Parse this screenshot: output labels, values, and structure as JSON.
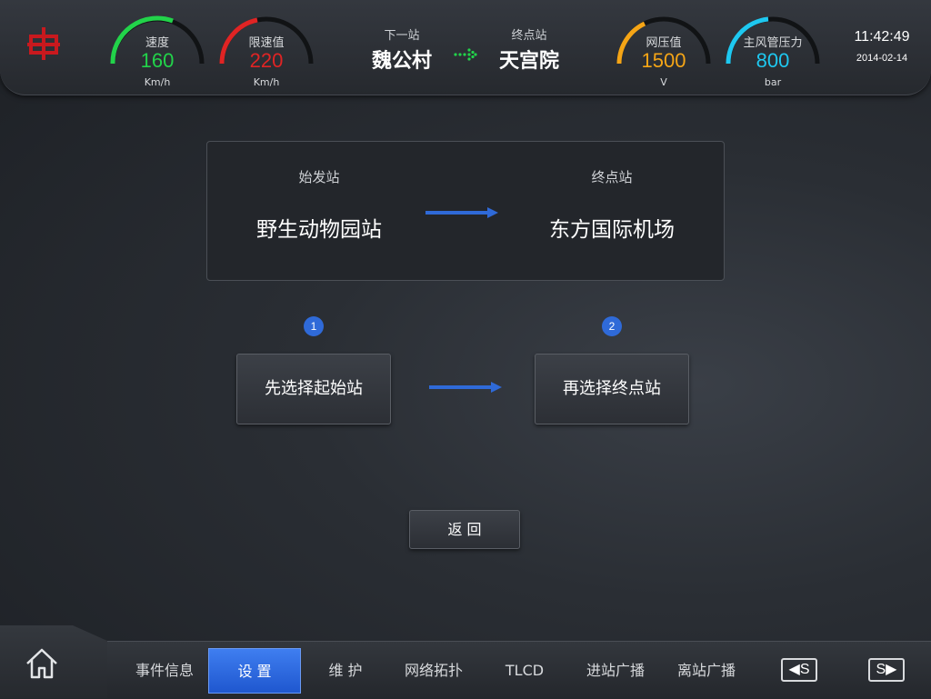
{
  "header": {
    "gauges": [
      {
        "label": "速度",
        "value": "160",
        "unit": "Km/h",
        "color": "#22d34a"
      },
      {
        "label": "限速值",
        "value": "220",
        "unit": "Km/h",
        "color": "#e02424"
      },
      {
        "label": "网压值",
        "value": "1500",
        "unit": "V",
        "color": "#f5a516"
      },
      {
        "label": "主风管压力",
        "value": "800",
        "unit": "bar",
        "color": "#1ec8f0"
      }
    ],
    "next_station": {
      "label": "下一站",
      "name": "魏公村"
    },
    "terminal_station": {
      "label": "终点站",
      "name": "天宫院"
    },
    "time": "11:42:49",
    "date": "2014-02-14",
    "logo_icon": "cr-logo-icon",
    "direction_icon": "dotted-arrow-right-icon"
  },
  "route": {
    "origin_label": "始发站",
    "origin": "野生动物园站",
    "terminal_label": "终点站",
    "terminal": "东方国际机场"
  },
  "steps": [
    {
      "number": "1",
      "button": "先选择起始站"
    },
    {
      "number": "2",
      "button": "再选择终点站"
    }
  ],
  "back_button": "返 回",
  "nav": {
    "items": [
      "事件信息",
      "设 置",
      "维 护",
      "网络拓扑",
      "TLCD",
      "进站广播",
      "离站广播"
    ],
    "active_index": 1,
    "prev_label": "S",
    "next_label": "S"
  },
  "colors": {
    "accent": "#2f6ad8",
    "logo": "#c8191e"
  }
}
